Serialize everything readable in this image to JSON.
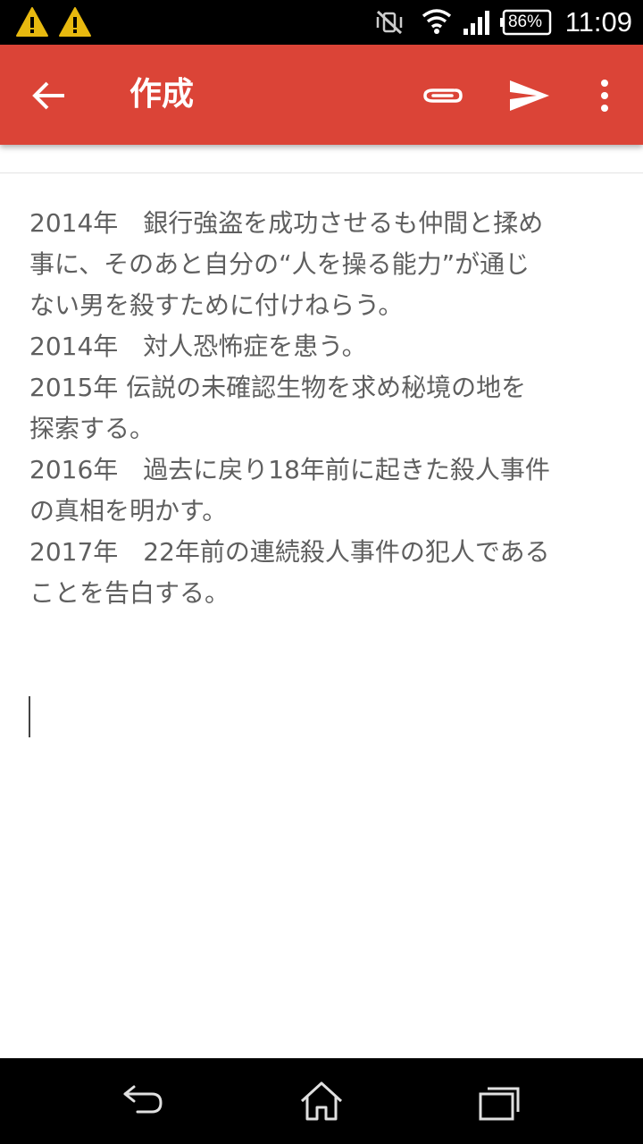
{
  "status_bar": {
    "battery": "86%",
    "time": "11:09",
    "icons": [
      "warning-icon",
      "warning-icon",
      "vibrate-off-icon",
      "wifi-icon",
      "signal-icon",
      "battery-icon"
    ]
  },
  "app_bar": {
    "title": "作成",
    "accent_color": "#db4437",
    "icons": [
      "back-arrow-icon",
      "paperclip-icon",
      "send-icon",
      "more-vert-icon"
    ]
  },
  "compose": {
    "lines": [
      "2014年　銀行強盗を成功させるも仲間と揉め",
      "事に、そのあと自分の“人を操る能力”が通じ",
      "ない男を殺すために付けねらう。",
      "2014年　対人恐怖症を患う。",
      "2015年 伝説の未確認生物を求め秘境の地を",
      "探索する。",
      "2016年　過去に戻り18年前に起きた殺人事件",
      "の真相を明かす。",
      "2017年　22年前の連続殺人事件の犯人である",
      "ことを告白する。"
    ]
  },
  "nav_bar": {
    "icons": [
      "nav-back-icon",
      "nav-home-icon",
      "nav-recents-icon"
    ]
  }
}
